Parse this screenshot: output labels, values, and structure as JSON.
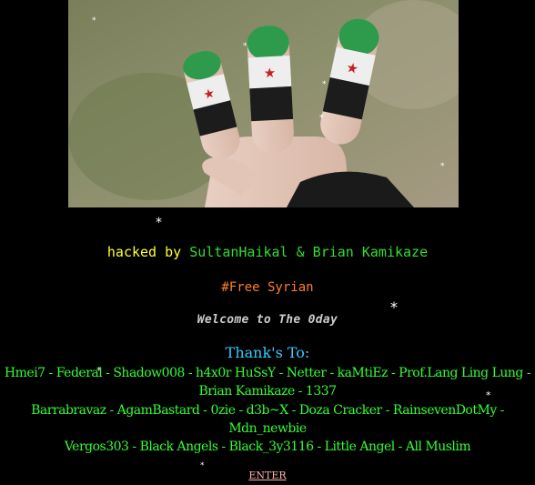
{
  "banner": {
    "image": "hand-with-syrian-flag-painted-fingers"
  },
  "hacked": {
    "prefix": "hacked by ",
    "names": "SultanHaikal & Brian Kamikaze"
  },
  "free_tag": "#Free Syrian",
  "welcome": "Welcome to The 0day",
  "thanks": {
    "heading": "Thank's To:",
    "lines": [
      "Hmei7 - Federal - Shadow008 - h4x0r HuSsY - Netter - kaMtiEz - Prof.Lang Ling Lung - Brian Kamikaze - 1337",
      "Barrabravaz - AgamBastard - 0zie - d3b~X - Doza Cracker - RainsevenDotMy - Mdn_newbie",
      "Vergos303 - Black Angels - Black_3y3116 - Little Angel - All Muslim"
    ]
  },
  "enter_label": "ENTER",
  "colors": {
    "background": "#000000",
    "hacked_prefix": "#ffff33",
    "names": "#33dd33",
    "free_tag": "#ff7f2a",
    "thanks_heading": "#33ccff",
    "credits": "#33ff33",
    "enter": "#ffb0b0"
  }
}
